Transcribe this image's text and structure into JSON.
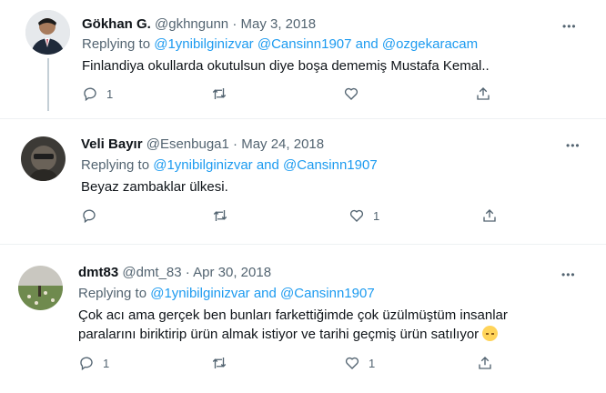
{
  "tweets": [
    {
      "name": "Gökhan G.",
      "handle": "@gkhngunn",
      "dot": "·",
      "date": "May 3, 2018",
      "replying_to": "Replying to",
      "mention1": "@1ynibilginizvar",
      "mention2": "@Cansinn1907",
      "and": "and",
      "mention3": "@ozgekaracam",
      "text": "Finlandiya okullarda okutulsun diye boşa dememiş Mustafa Kemal..",
      "reply_count": "1",
      "retweet_count": "",
      "like_count": "",
      "more": "•••"
    },
    {
      "name": "Veli Bayır",
      "handle": "@Esenbuga1",
      "dot": "·",
      "date": "May 24, 2018",
      "replying_to": "Replying to",
      "mention1": "@1ynibilginizvar",
      "and": "and",
      "mention2": "@Cansinn1907",
      "text": "Beyaz zambaklar ülkesi.",
      "reply_count": "",
      "retweet_count": "",
      "like_count": "1",
      "more": "•••"
    },
    {
      "name": "dmt83",
      "handle": "@dmt_83",
      "dot": "·",
      "date": "Apr 30, 2018",
      "replying_to": "Replying to",
      "mention1": "@1ynibilginizvar",
      "and": "and",
      "mention2": "@Cansinn1907",
      "text_line1": "Çok acı ama gerçek ben bunları farkettiğimde çok üzülmüştüm insanlar",
      "text_line2": "paralarını biriktirip ürün almak istiyor ve tarihi geçmiş ürün satılıyor",
      "reply_count": "1",
      "retweet_count": "",
      "like_count": "1",
      "more": "•••"
    }
  ]
}
